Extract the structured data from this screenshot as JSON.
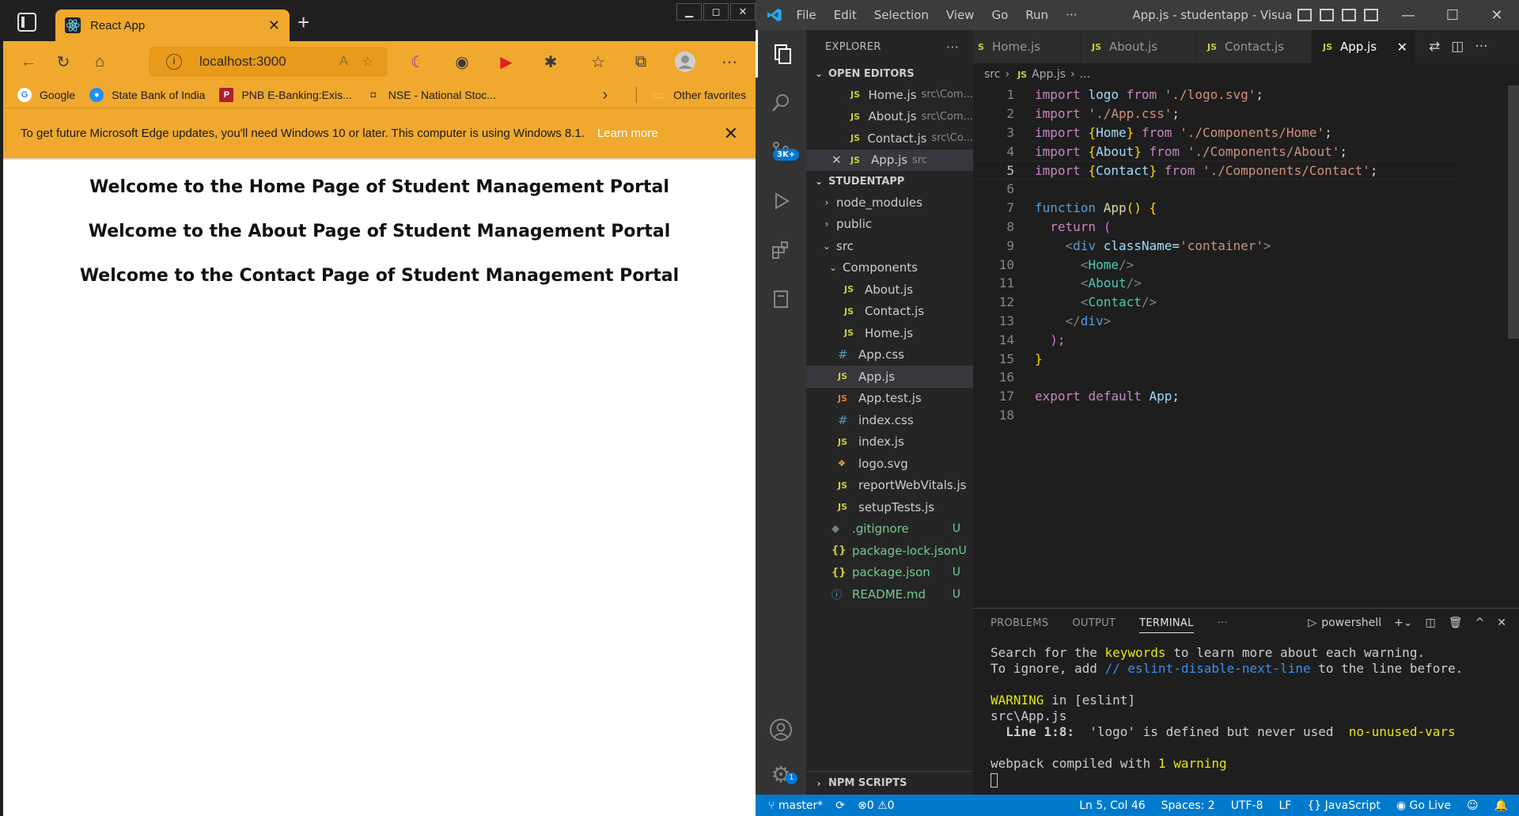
{
  "browser": {
    "tab_title": "React App",
    "url": "localhost:3000",
    "favorites": [
      "Google",
      "State Bank of India",
      "PNB E-Banking:Exis...",
      "NSE - National Stoc..."
    ],
    "other_favorites": "Other favorites",
    "infobar_message": "To get future Microsoft Edge updates, you'll need Windows 10 or later. This computer is using Windows 8.1.",
    "infobar_link": "Learn more",
    "page_headings": [
      "Welcome to the Home Page of Student Management Portal",
      "Welcome to the About Page of Student Management Portal",
      "Welcome to the Contact Page of Student Management Portal"
    ],
    "accent_color": "#f0a92e"
  },
  "vscode": {
    "menu": [
      "File",
      "Edit",
      "Selection",
      "View",
      "Go",
      "Run",
      "···"
    ],
    "window_title": "App.js - studentapp - Visual Stu...",
    "explorer_title": "EXPLORER",
    "open_editors_label": "OPEN EDITORS",
    "open_editors": [
      {
        "name": "Home.js",
        "path": "src\\Com..."
      },
      {
        "name": "About.js",
        "path": "src\\Com..."
      },
      {
        "name": "Contact.js",
        "path": "src\\Co..."
      },
      {
        "name": "App.js",
        "path": "src"
      }
    ],
    "project_label": "STUDENTAPP",
    "tree": {
      "node_modules": "node_modules",
      "public": "public",
      "src": "src",
      "components": "Components",
      "comp_files": [
        "About.js",
        "Contact.js",
        "Home.js"
      ],
      "src_files": [
        "App.css",
        "App.js",
        "App.test.js",
        "index.css",
        "index.js",
        "logo.svg",
        "reportWebVitals.js",
        "setupTests.js"
      ],
      "root_files": [
        ".gitignore",
        "package-lock.json",
        "package.json",
        "README.md"
      ],
      "git_status": "U"
    },
    "npm_scripts_label": "NPM SCRIPTS",
    "editor_tabs": [
      "Home.js",
      "About.js",
      "Contact.js",
      "App.js"
    ],
    "breadcrumb": {
      "folder": "src",
      "file": "App.js",
      "more": "..."
    },
    "line_numbers": [
      "1",
      "2",
      "3",
      "4",
      "5",
      "6",
      "7",
      "8",
      "9",
      "10",
      "11",
      "12",
      "13",
      "14",
      "15",
      "16",
      "17",
      "18"
    ],
    "code": {
      "l1": {
        "kw": "import",
        "id": "logo",
        "from": "from",
        "str": "'./logo.svg'",
        "semi": ";"
      },
      "l2": {
        "kw": "import",
        "str": "'./App.css'",
        "semi": ";"
      },
      "l3": {
        "kw": "import",
        "id": "Home",
        "from": "from",
        "str": "'./Components/Home'",
        "semi": ";"
      },
      "l4": {
        "kw": "import",
        "id": "About",
        "from": "from",
        "str": "'./Components/About'",
        "semi": ";"
      },
      "l5": {
        "kw": "import",
        "id": "Contact",
        "from": "from",
        "str": "'./Components/Contact'",
        "semi": ";"
      },
      "l7": {
        "kw": "function",
        "fn": "App",
        "rest": "() {"
      },
      "l8": {
        "kw": "return",
        "rest": "("
      },
      "l9": {
        "tag": "div",
        "attr": "className",
        "str": "'container'"
      },
      "l10": "Home",
      "l11": "About",
      "l12": "Contact",
      "l13": "div",
      "l14": ");",
      "l15": "}",
      "l17": {
        "kw1": "export",
        "kw2": "default",
        "id": "App",
        "semi": ";"
      }
    },
    "panel_tabs": [
      "PROBLEMS",
      "OUTPUT",
      "TERMINAL",
      "···"
    ],
    "terminal_shell": "powershell",
    "terminal": {
      "line1_pre": "Search for the ",
      "line1_kw": "keywords",
      "line1_post": " to learn more about each warning.",
      "line2_pre": "To ignore, add ",
      "line2_kw": "// eslint-disable-next-line",
      "line2_post": " to the line before.",
      "warn_label": "WARNING",
      "warn_rest": " in [eslint]",
      "file": "src\\App.js",
      "line_ref": "  Line 1:8:",
      "message": "  'logo' is defined but never used  ",
      "rule": "no-unused-vars",
      "compiled_pre": "webpack compiled with ",
      "compiled_count": "1 warning"
    },
    "statusbar": {
      "branch": "master*",
      "errors": "0",
      "warnings": "0",
      "position": "Ln 5, Col 46",
      "spaces": "Spaces: 2",
      "encoding": "UTF-8",
      "eol": "LF",
      "language": "JavaScript",
      "golive": "Go Live"
    },
    "activity_badge": "3K+",
    "settings_badge": "1",
    "accent_color": "#007acc"
  }
}
